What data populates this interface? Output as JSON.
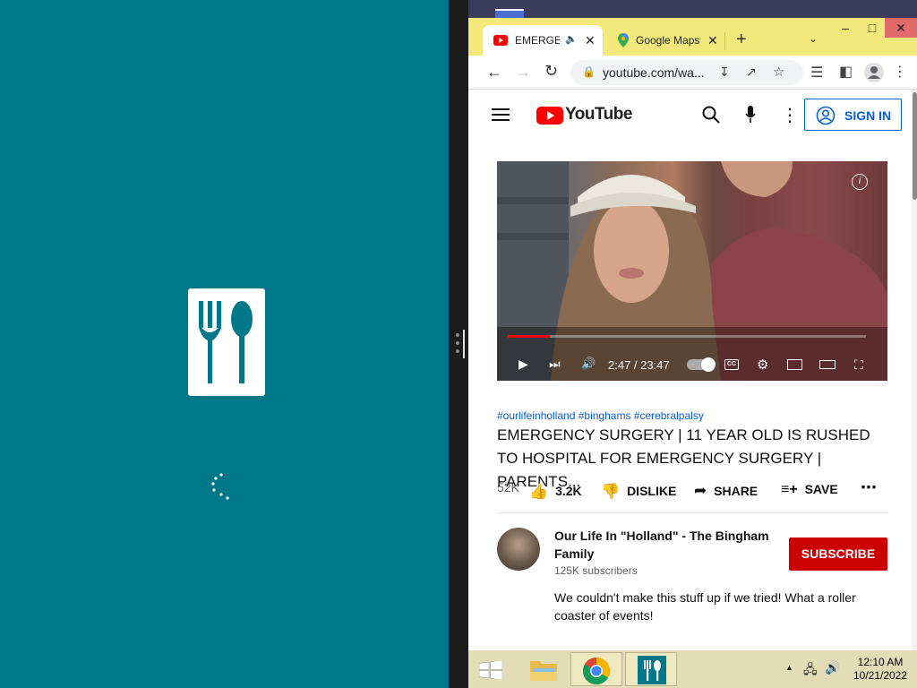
{
  "browser": {
    "tabs": [
      {
        "label": "EMERGENCY",
        "active": true,
        "icon": "youtube-icon"
      },
      {
        "label": "Google Maps",
        "active": false,
        "icon": "maps-pin-icon"
      }
    ],
    "new_tab": "+",
    "url": "youtube.com/wa..."
  },
  "youtube": {
    "logo_text": "YouTube",
    "signin_label": "SIGN IN",
    "video": {
      "current_time": "2:47 / 23:47",
      "progress": 0.117
    },
    "hashtags": "#ourlifeinholland #binghams #cerebralpalsy",
    "title": "EMERGENCY SURGERY | 11 YEAR OLD IS RUSHED TO HOSPITAL FOR EMERGENCY SURGERY | PARENTS...",
    "views": "52K",
    "actions": {
      "like": "3.2K",
      "dislike": "DISLIKE",
      "share": "SHARE",
      "save": "SAVE"
    },
    "channel": {
      "name": "Our Life In \"Holland\" - The Bingham Family",
      "subscribers": "125K subscribers",
      "subscribe_label": "SUBSCRIBE"
    },
    "description": "We couldn't make this stuff up if we tried! What a roller coaster of events!"
  },
  "taskbar": {
    "time": "12:10 AM",
    "date": "10/21/2022"
  },
  "colors": {
    "left_app_bg": "#00788a",
    "chrome_frame": "#f3e97a",
    "youtube_red": "#ff0000",
    "subscribe_red": "#cc0000",
    "link_blue": "#065fd4"
  }
}
